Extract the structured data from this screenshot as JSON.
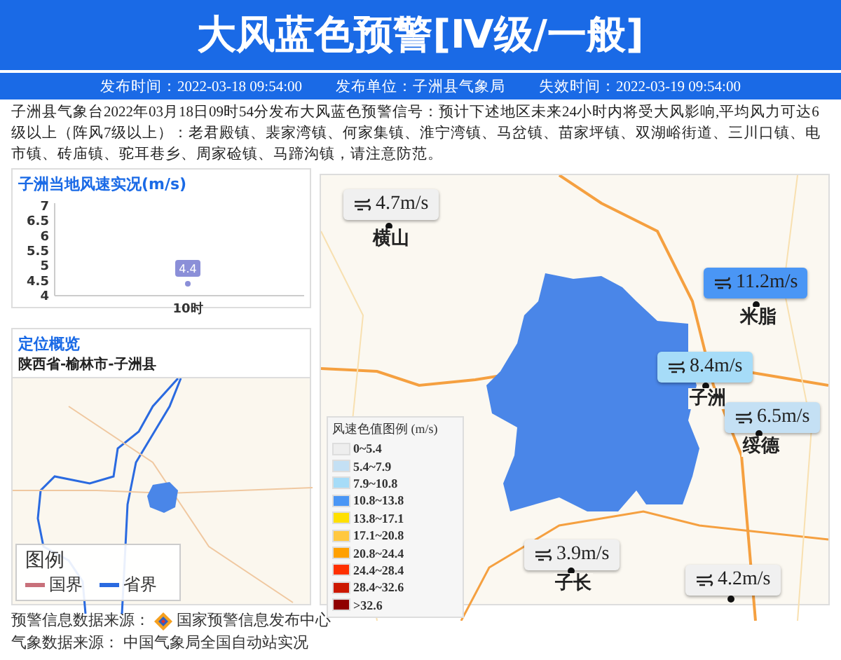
{
  "header": {
    "title": "大风蓝色预警[Ⅳ级/一般]"
  },
  "info_bar": [
    {
      "label": "发布时间：",
      "value": "2022-03-18 09:54:00"
    },
    {
      "label": "发布单位：",
      "value": "子洲县气象局"
    },
    {
      "label": "失效时间：",
      "value": "2022-03-19 09:54:00"
    }
  ],
  "description": "子洲县气象台2022年03月18日09时54分发布大风蓝色预警信号：预计下述地区未来24小时内将受大风影响,平均风力可达6级以上（阵风7级以上）：老君殿镇、裴家湾镇、何家集镇、淮宁湾镇、马岔镇、苗家坪镇、双湖峪街道、三川口镇、电市镇、砖庙镇、驼耳巷乡、周家硷镇、马蹄沟镇，请注意防范。",
  "wind_chart": {
    "title": "子洲当地风速实况(m/s)",
    "chart_data": {
      "type": "line",
      "categories": [
        "10时"
      ],
      "series": [
        {
          "color": "#8b8fd8",
          "values": [
            4.4
          ],
          "marker": true
        }
      ],
      "ylim": [
        4,
        7
      ],
      "yticks": [
        4,
        4.5,
        5,
        5.5,
        6,
        6.5,
        7
      ],
      "data_labels": true
    }
  },
  "location": {
    "title": "定位概览",
    "path": "陕西省-榆林市-子洲县",
    "legend_title": "图例",
    "legend": [
      {
        "label": "国界",
        "color": "#c8707a"
      },
      {
        "label": "省界",
        "color": "#2a6ae0"
      }
    ]
  },
  "map": {
    "stations": [
      {
        "speed": "4.7m/s",
        "town": "横山",
        "color": "#f0f0f0"
      },
      {
        "speed": "11.2m/s",
        "town": "米脂",
        "color": "#4a96f5"
      },
      {
        "speed": "8.4m/s",
        "town": "子洲",
        "color": "#a6dcf8"
      },
      {
        "speed": "6.5m/s",
        "town": "绥德",
        "color": "#c4e0f4"
      },
      {
        "speed": "3.9m/s",
        "town": "子长",
        "color": "#f0f0f0"
      },
      {
        "speed": "4.2m/s",
        "color": "#f0f0f0"
      }
    ],
    "legend_title": "风速色值图例 (m/s)",
    "legend": [
      {
        "label": "0~5.4",
        "color": "#eeeeee"
      },
      {
        "label": "5.4~7.9",
        "color": "#c4e0f4"
      },
      {
        "label": "7.9~10.8",
        "color": "#a6dcf8"
      },
      {
        "label": "10.8~13.8",
        "color": "#4a96f5"
      },
      {
        "label": "13.8~17.1",
        "color": "#ffe000"
      },
      {
        "label": "17.1~20.8",
        "color": "#ffc840"
      },
      {
        "label": "20.8~24.4",
        "color": "#ffa000"
      },
      {
        "label": "24.4~28.4",
        "color": "#ff3000"
      },
      {
        "label": "28.4~32.6",
        "color": "#cc1800"
      },
      {
        "label": ">32.6",
        "color": "#900000"
      }
    ]
  },
  "sources": [
    {
      "label": "预警信息数据来源：",
      "value": "国家预警信息发布中心"
    },
    {
      "label": "气象数据来源：",
      "value": "中国气象局全国自动站实况"
    }
  ]
}
